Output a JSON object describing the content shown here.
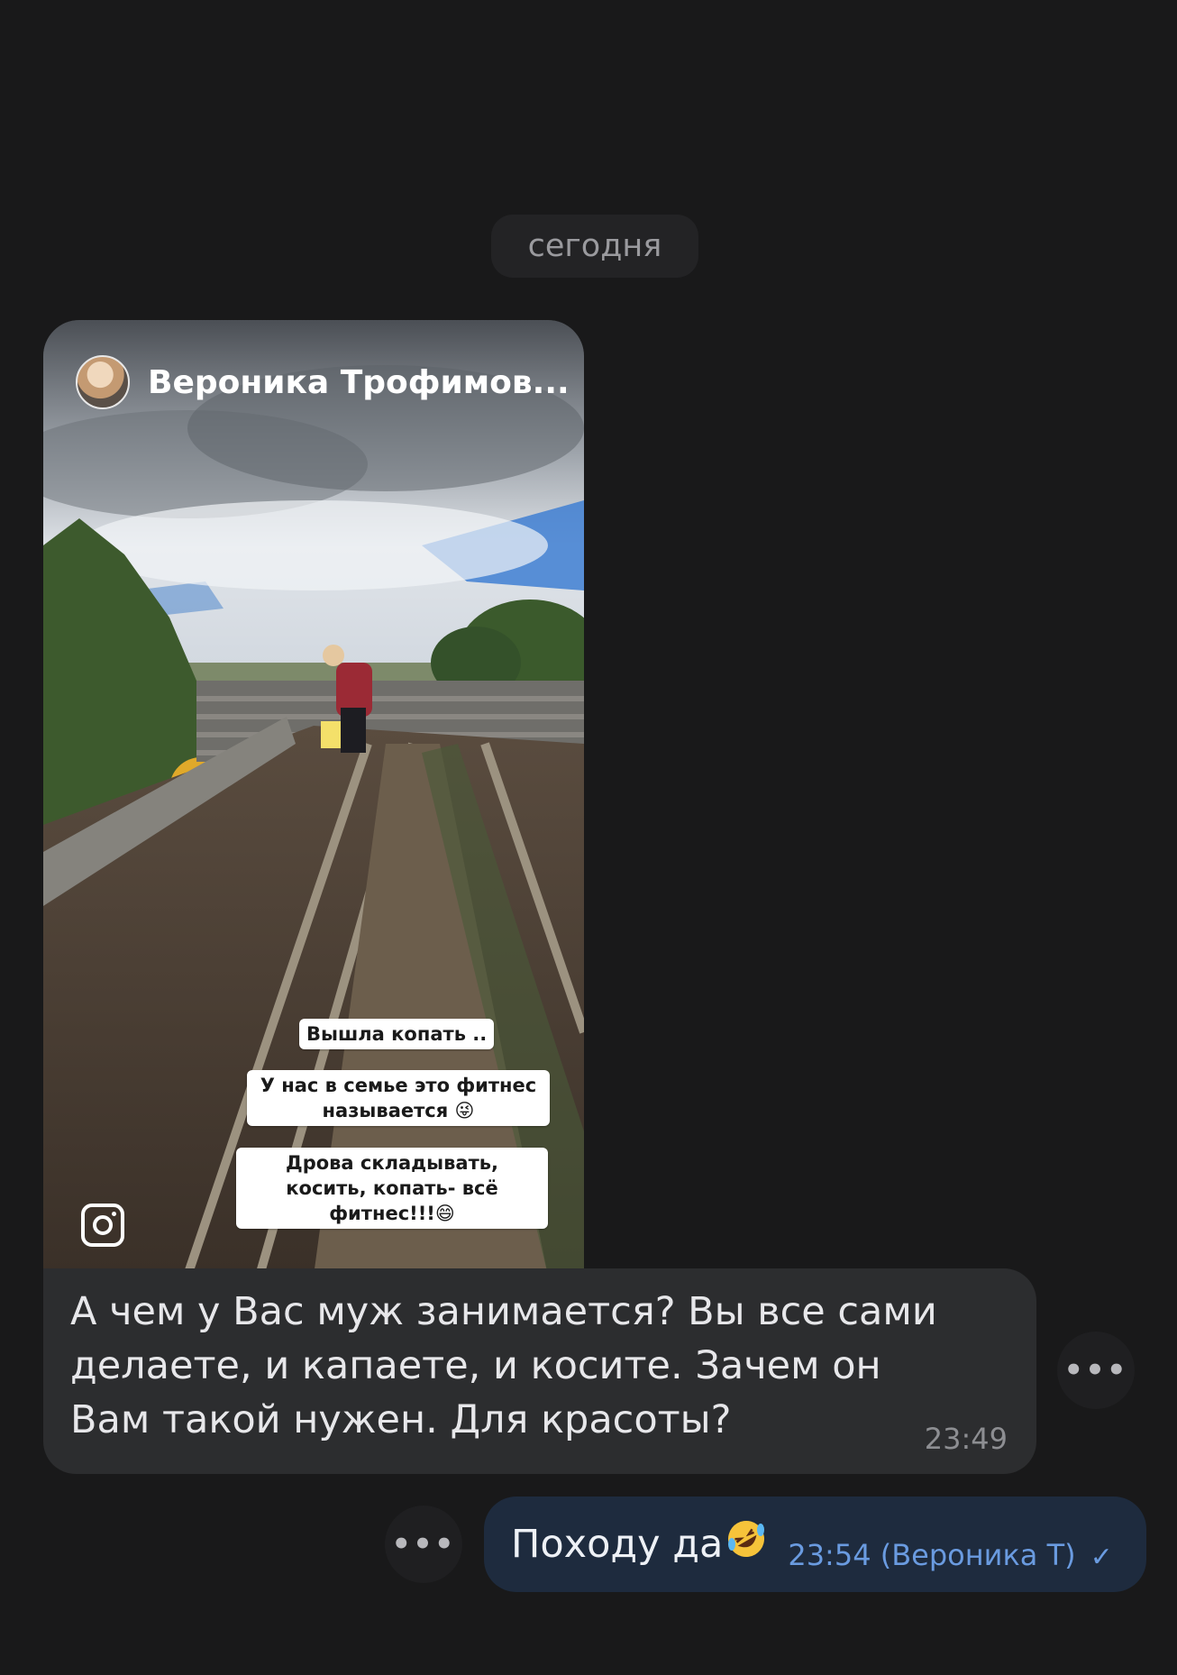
{
  "date_separator": "сегодня",
  "story": {
    "author": "Вероника Трофимов...",
    "captions": [
      "Вышла копать ..",
      "У нас в семье это фитнес называется 😜",
      "Дрова складывать, косить, копать- всё фитнес!!!😄"
    ],
    "icon": "instagram-icon"
  },
  "incoming": {
    "text": "А чем у Вас муж занимается? Вы все сами делаете, и капаете, и косите. Зачем он Вам такой нужен. Для красоты?",
    "time": "23:49",
    "more_icon": "more-dots-icon"
  },
  "outgoing": {
    "text": "Походу да",
    "emoji": "rolling-on-floor-laughing-emoji",
    "meta": "23:54 (Вероника Т)",
    "status_icon": "check-icon",
    "more_icon": "more-dots-icon"
  },
  "colors": {
    "background": "#19191a",
    "incoming_bubble": "#2c2d2f",
    "outgoing_bubble": "#1e2b3e",
    "accent": "#6a9be0"
  }
}
